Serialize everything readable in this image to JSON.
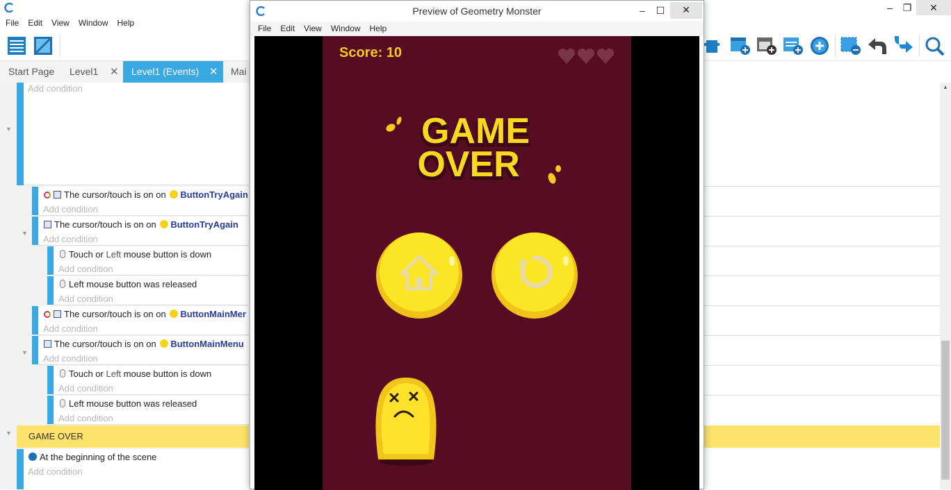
{
  "app": {
    "menu": [
      "File",
      "Edit",
      "View",
      "Window",
      "Help"
    ]
  },
  "tabs": [
    {
      "label": "Start Page"
    },
    {
      "label": "Level1",
      "close": "✕"
    },
    {
      "label": "Level1 (Events)",
      "close": "✕"
    },
    {
      "label": "Mai"
    }
  ],
  "events": {
    "add_condition": "Add condition",
    "ev1": {
      "prefix": "The cursor/touch is on",
      "object": "ButtonTryAgain"
    },
    "ev2": {
      "prefix": "The cursor/touch is on",
      "object": "ButtonTryAgain"
    },
    "ev2a": {
      "text1": "Touch or ",
      "text2": "Left",
      "text3": " mouse button is down"
    },
    "ev2b": {
      "text": "Left mouse button was released"
    },
    "ev3": {
      "prefix": "The cursor/touch is on",
      "object": "ButtonMainMer"
    },
    "ev4": {
      "prefix": "The cursor/touch is on",
      "object": "ButtonMainMenu"
    },
    "ev4a": {
      "text1": "Touch or ",
      "text2": "Left",
      "text3": " mouse button is down"
    },
    "ev4b": {
      "text": "Left mouse button was released"
    },
    "group": "GAME OVER",
    "ev5": {
      "text": "At the beginning of the scene"
    }
  },
  "preview": {
    "title": "Preview of Geometry Monster",
    "menu": [
      "File",
      "Edit",
      "View",
      "Window",
      "Help"
    ],
    "score_label": "Score: 10",
    "lives": 3,
    "headline1": "GAME",
    "headline2": "OVER"
  },
  "colors": {
    "accent": "#3aa8e2",
    "game_bg": "#560d23",
    "group_bg": "#fde26b",
    "coin": "#f6d21a"
  }
}
